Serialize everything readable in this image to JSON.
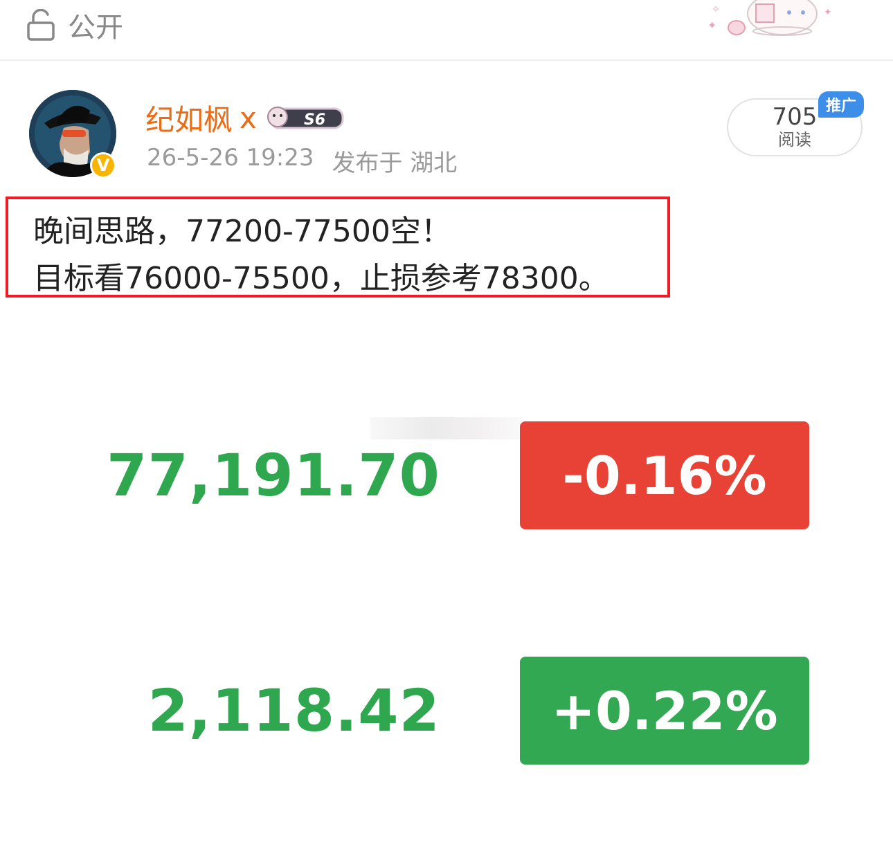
{
  "topbar": {
    "visibility_label": "公开",
    "visibility_icon": "unlock-icon"
  },
  "author": {
    "name": "纪如枫",
    "name_suffix": "x",
    "badge_text": "S6",
    "verified": true
  },
  "meta": {
    "timestamp": "26-5-26 19:23",
    "location": "发布于 湖北"
  },
  "stats": {
    "reads_count": "705",
    "reads_label": "阅读",
    "promo_tag": "推广"
  },
  "post": {
    "line1": "晚间思路，77200-77500空！",
    "line2": "目标看76000-75500，止损参考78300。"
  },
  "quotes": [
    {
      "price": "77,191.70",
      "change": "-0.16%",
      "color": "#e84236"
    },
    {
      "price": "2,118.42",
      "change": "+0.22%",
      "color": "#33a852"
    }
  ],
  "colors": {
    "username": "#ea6c17",
    "price_text": "#2ea74f",
    "highlight_border": "#ee1c24",
    "promo": "#3d8ee8"
  }
}
